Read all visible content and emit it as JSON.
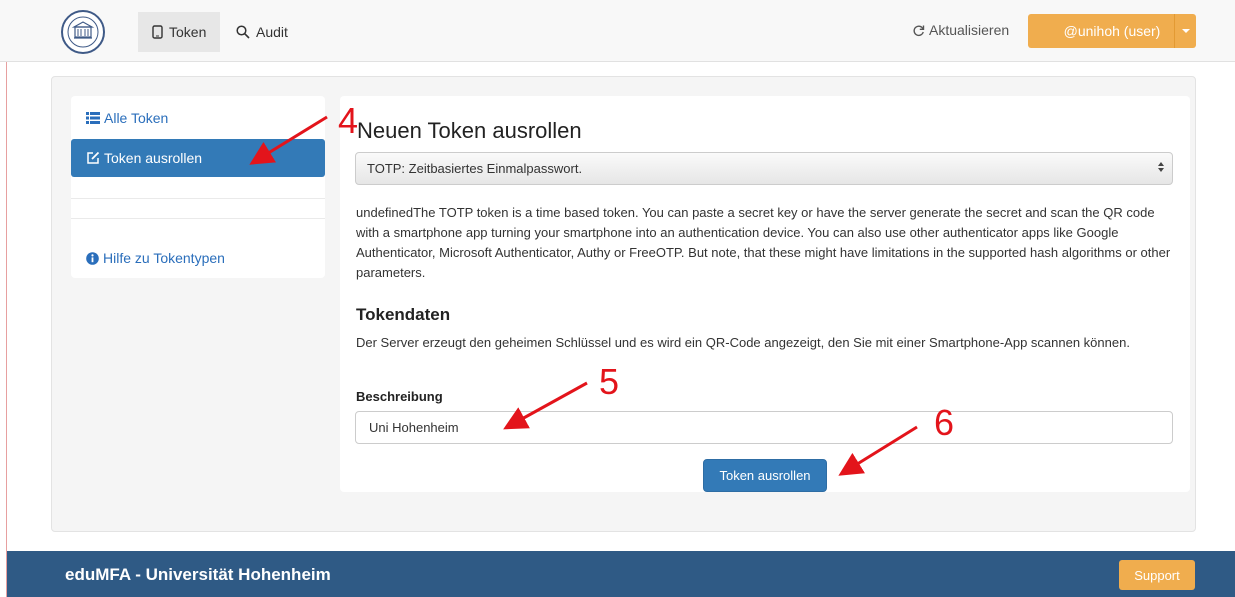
{
  "nav": {
    "tabs": [
      {
        "label": "Token",
        "icon": "mobile-icon",
        "active": true
      },
      {
        "label": "Audit",
        "icon": "search-icon",
        "active": false
      }
    ],
    "refresh_label": "Aktualisieren",
    "user_label": "@unihoh (user)"
  },
  "sidebar": {
    "items": [
      {
        "label": "Alle Token",
        "icon": "list-icon"
      },
      {
        "label": "Token ausrollen",
        "icon": "edit-icon",
        "active": true
      },
      {
        "label": "Hilfe zu Tokentypen",
        "icon": "info-circle-icon"
      }
    ]
  },
  "main": {
    "title": "Neuen Token ausrollen",
    "token_type_selected": "TOTP: Zeitbasiertes Einmalpasswort.",
    "description": "undefinedThe TOTP token is a time based token. You can paste a secret key or have the server generate the secret and scan the QR code with a smartphone app turning your smartphone into an authentication device. You can also use other authenticator apps like Google Authenticator, Microsoft Authenticator, Authy or FreeOTP. But note, that these might have limitations in the supported hash algorithms or other parameters.",
    "tokendata_heading": "Tokendaten",
    "tokendata_info": "Der Server erzeugt den geheimen Schlüssel und es wird ein QR-Code angezeigt, den Sie mit einer Smartphone-App scannen können.",
    "description_label": "Beschreibung",
    "description_value": "Uni Hohenheim",
    "submit_label": "Token ausrollen"
  },
  "annotations": [
    "4",
    "5",
    "6"
  ],
  "footer": {
    "text": "eduMFA - Universität Hohenheim",
    "support_label": "Support"
  },
  "colors": {
    "primary": "#337ab7",
    "warning": "#f0ad4e",
    "footer": "#2f5a85",
    "annotation": "#e3141b"
  }
}
